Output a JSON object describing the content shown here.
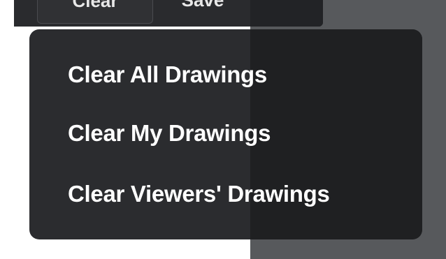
{
  "toolbar": {
    "clear_label": "Clear",
    "save_label": "Save"
  },
  "clear_menu": {
    "items": [
      {
        "label": "Clear All Drawings"
      },
      {
        "label": "Clear My Drawings"
      },
      {
        "label": "Clear Viewers' Drawings"
      }
    ]
  },
  "colors": {
    "menu_background": "#2b2c2f",
    "menu_text": "#ffffff",
    "toolbar_background": "#2a2b2e",
    "side_surface": "#57595c"
  }
}
